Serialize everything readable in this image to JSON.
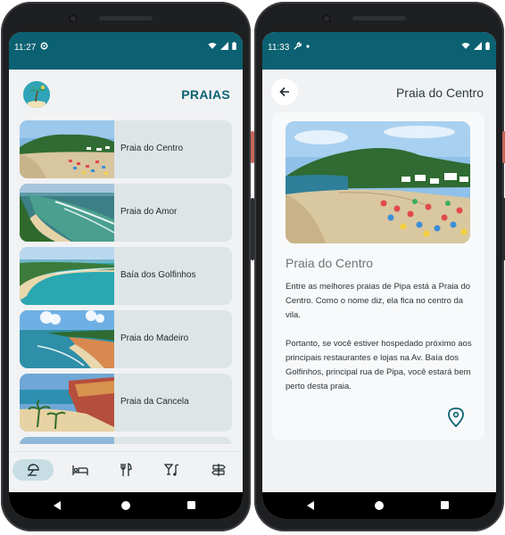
{
  "phone_left": {
    "status": {
      "time": "11:27"
    },
    "header": {
      "title": "PRAIAS",
      "logo_icon": "palm-tree-icon"
    },
    "beaches": [
      {
        "name": "Praia do Centro"
      },
      {
        "name": "Praia do Amor"
      },
      {
        "name": "Baía dos Golfinhos"
      },
      {
        "name": "Praia do Madeiro"
      },
      {
        "name": "Praia da Cancela"
      }
    ],
    "bottom_nav": [
      {
        "icon": "beach-umbrella-icon",
        "active": true
      },
      {
        "icon": "bed-icon",
        "active": false
      },
      {
        "icon": "fork-knife-icon",
        "active": false
      },
      {
        "icon": "cocktail-music-icon",
        "active": false
      },
      {
        "icon": "signpost-icon",
        "active": false
      }
    ]
  },
  "phone_right": {
    "status": {
      "time": "11:33"
    },
    "header": {
      "title": "Praia do Centro",
      "back_icon": "arrow-left-icon"
    },
    "detail": {
      "title": "Praia do Centro",
      "paragraph_1": "Entre as melhores praias de Pipa está a Praia do Centro. Como o nome diz, ela fica no centro da vila.",
      "paragraph_2": "Portanto, se você estiver hospedado próximo aos principais restaurantes e lojas na Av. Baía dos Golfinhos, principal rua de Pipa, você estará bem perto desta praia.",
      "map_icon": "map-pin-icon"
    }
  },
  "colors": {
    "status_bar": "#0b6171",
    "accent": "#0b6171",
    "card_bg": "#dde5e7",
    "nav_active": "#c6dde4"
  }
}
